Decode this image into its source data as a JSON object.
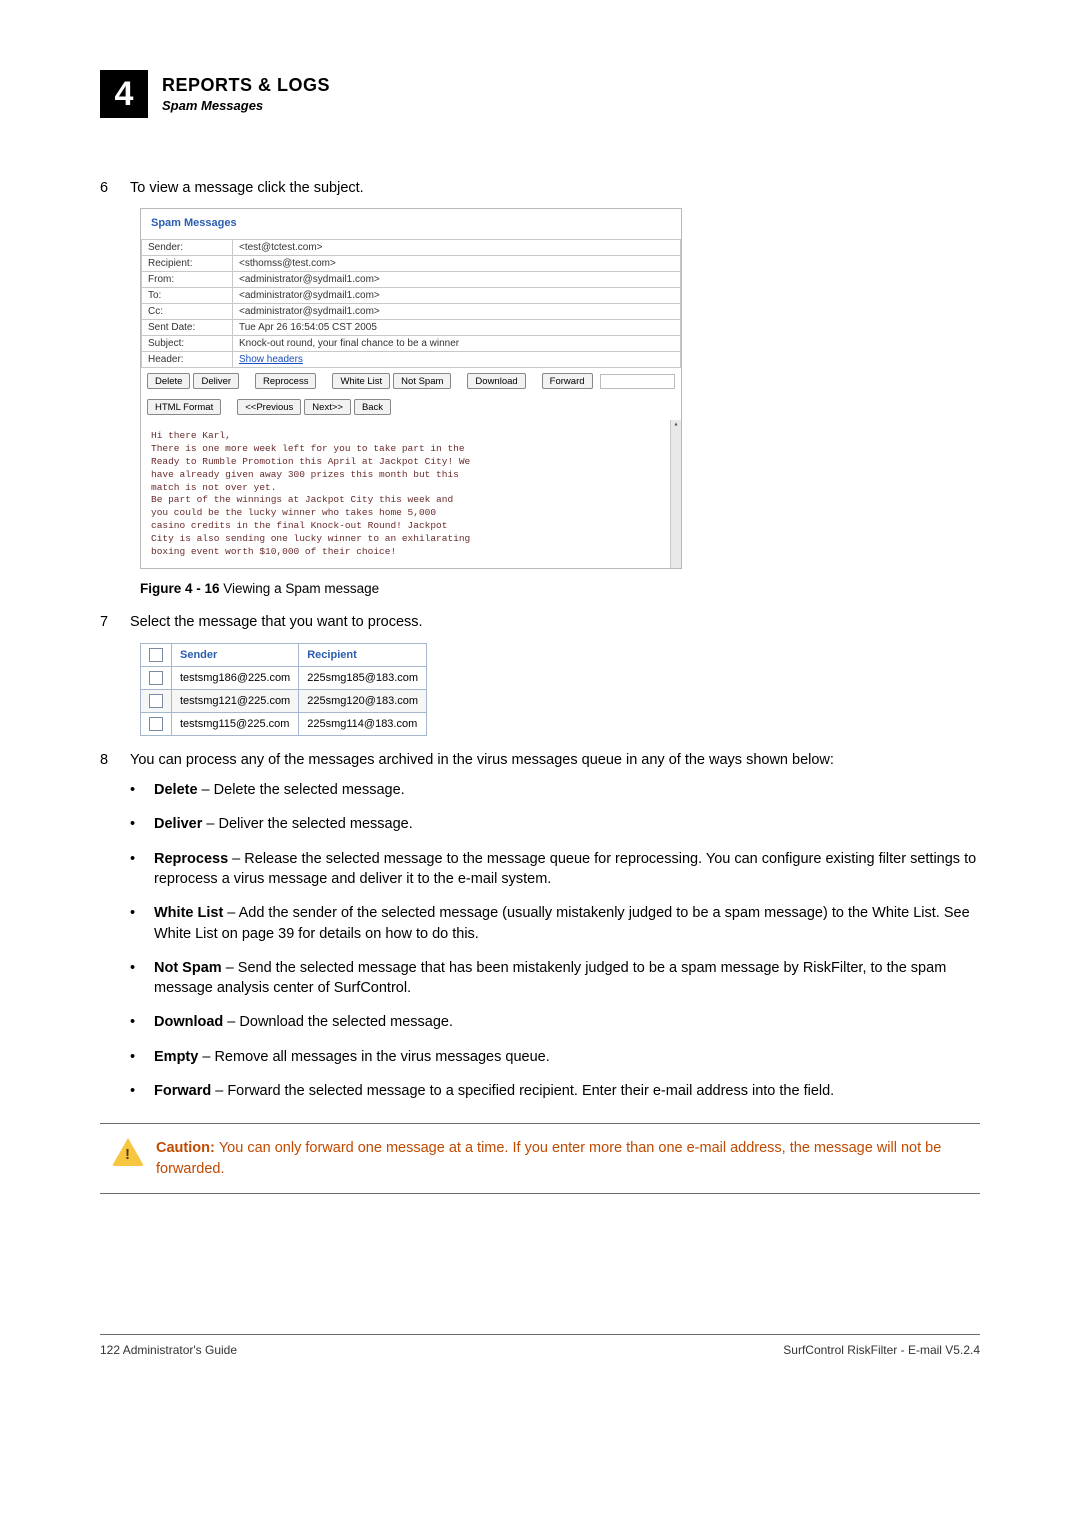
{
  "chapter": {
    "number": "4",
    "title": "REPORTS & LOGS",
    "subtitle": "Spam Messages"
  },
  "step6": {
    "num": "6",
    "text": "To view a message click the subject."
  },
  "spam_panel": {
    "title": "Spam Messages",
    "rows": {
      "sender_k": "Sender:",
      "sender_v": "<test@tctest.com>",
      "recipient_k": "Recipient:",
      "recipient_v": "<sthomss@test.com>",
      "from_k": "From:",
      "from_v": "<administrator@sydmail1.com>",
      "to_k": "To:",
      "to_v": "<administrator@sydmail1.com>",
      "cc_k": "Cc:",
      "cc_v": "<administrator@sydmail1.com>",
      "sent_k": "Sent Date:",
      "sent_v": "Tue Apr 26 16:54:05 CST 2005",
      "subj_k": "Subject:",
      "subj_v": "Knock-out round, your final chance to be a winner",
      "head_k": "Header:",
      "head_v": "Show headers"
    },
    "buttons1": {
      "delete": "Delete",
      "deliver": "Deliver",
      "reprocess": "Reprocess",
      "whitelist": "White List",
      "notspam": "Not Spam",
      "download": "Download",
      "forward": "Forward"
    },
    "buttons2": {
      "html": "HTML Format",
      "prev": "<<Previous",
      "next": "Next>>",
      "back": "Back"
    },
    "body_lines": [
      "Hi there Karl,",
      "",
      "There is one more week left for you to take part in the",
      "Ready to Rumble Promotion this April at Jackpot City! We",
      "have already given away 300 prizes this month but this",
      "match is not over yet.",
      "",
      "Be part of the winnings at Jackpot City this week and",
      "you could be the lucky winner who takes home 5,000",
      "casino credits in the final Knock-out Round! Jackpot",
      "City is also sending one lucky winner to an exhilarating",
      "boxing event worth $10,000 of their choice!"
    ]
  },
  "figure416": {
    "label": "Figure 4 - 16",
    "caption": " Viewing a Spam message"
  },
  "step7": {
    "num": "7",
    "text": "Select the message that you want to process."
  },
  "mini_table": {
    "head": {
      "sender": "Sender",
      "recipient": "Recipient"
    },
    "rows": [
      {
        "sender": "testsmg186@225.com",
        "recipient": "225smg185@183.com"
      },
      {
        "sender": "testsmg121@225.com",
        "recipient": "225smg120@183.com"
      },
      {
        "sender": "testsmg115@225.com",
        "recipient": "225smg114@183.com"
      }
    ]
  },
  "step8": {
    "num": "8",
    "text": "You can process any of the messages archived in the virus messages queue in any of the ways shown below:"
  },
  "bullets": {
    "delete": {
      "t": "Delete",
      "d": " – Delete the selected message."
    },
    "deliver": {
      "t": "Deliver",
      "d": " – Deliver the selected message."
    },
    "reprocess": {
      "t": "Reprocess",
      "d": " – Release the selected message to the message queue for reprocessing. You can configure existing filter settings to reprocess a virus message and deliver it to the e-mail system."
    },
    "whitelist": {
      "t": "White List",
      "d": " – Add the sender of the selected message (usually mistakenly judged to be a spam message) to the White List. See White List on page 39 for details on how to do this."
    },
    "notspam": {
      "t": "Not Spam",
      "d": " – Send the selected message that has been mistakenly judged to be a spam message by RiskFilter, to the spam message analysis center of SurfControl."
    },
    "download": {
      "t": "Download",
      "d": " – Download the selected message."
    },
    "empty": {
      "t": "Empty",
      "d": " – Remove all messages in the virus messages queue."
    },
    "forward": {
      "t": "Forward",
      "d": " – Forward the selected message to a specified recipient. Enter their e-mail address into the field."
    }
  },
  "caution": {
    "label": "Caution:  ",
    "text": "You can only forward one message at a time. If you enter more than one e-mail address, the message will not be forwarded."
  },
  "footer": {
    "left": "122  Administrator's Guide",
    "right": "SurfControl RiskFilter - E-mail V5.2.4"
  }
}
